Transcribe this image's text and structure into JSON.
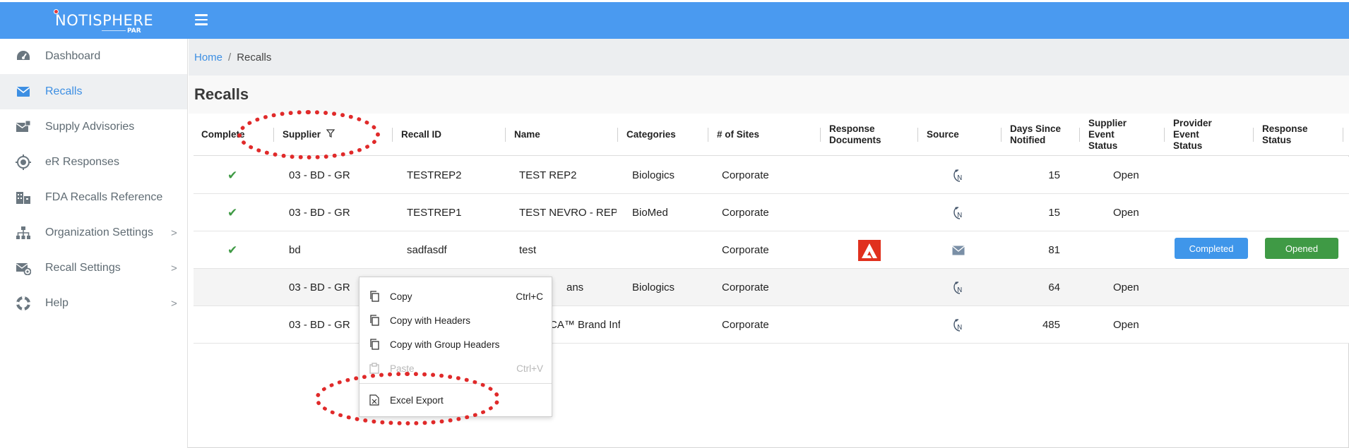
{
  "app": {
    "logo_text": "NOTISPHERE",
    "logo_sub": "PAR"
  },
  "sidebar": {
    "items": [
      {
        "label": "Dashboard",
        "icon": "dashboard-icon"
      },
      {
        "label": "Recalls",
        "icon": "envelope-icon",
        "active": true
      },
      {
        "label": "Supply Advisories",
        "icon": "advisory-icon"
      },
      {
        "label": "eR Responses",
        "icon": "target-icon"
      },
      {
        "label": "FDA Recalls Reference",
        "icon": "building-icon"
      },
      {
        "label": "Organization Settings",
        "icon": "org-chart-icon",
        "chevron": ">"
      },
      {
        "label": "Recall Settings",
        "icon": "mail-settings-icon",
        "chevron": ">"
      },
      {
        "label": "Help",
        "icon": "lifebuoy-icon",
        "chevron": ">"
      }
    ]
  },
  "breadcrumb": {
    "home": "Home",
    "separator": "/",
    "current": "Recalls"
  },
  "page": {
    "title": "Recalls"
  },
  "grid": {
    "columns": [
      "Complete",
      "Supplier",
      "Recall ID",
      "Name",
      "Categories",
      "# of Sites",
      "Response Documents",
      "Source",
      "Days Since Notified",
      "Supplier Event Status",
      "Provider Event Status",
      "Response Status"
    ],
    "rows": [
      {
        "complete": "✔",
        "supplier": "03 - BD - GR",
        "recall_id": "TESTREP2",
        "name": "TEST REP2",
        "categories": "Biologics",
        "sites": "Corporate",
        "doc": "",
        "source": "N",
        "days": "15",
        "supplier_status": "Open",
        "provider_status": "",
        "response_status": ""
      },
      {
        "complete": "✔",
        "supplier": "03 - BD - GR",
        "recall_id": "TESTREP1",
        "name": "TEST NEVRO - REP",
        "categories": "BioMed",
        "sites": "Corporate",
        "doc": "",
        "source": "N",
        "days": "15",
        "supplier_status": "Open",
        "provider_status": "",
        "response_status": ""
      },
      {
        "complete": "✔",
        "supplier": "bd",
        "recall_id": "sadfasdf",
        "name": "test",
        "categories": "",
        "sites": "Corporate",
        "doc": "pdf",
        "source": "mail",
        "days": "81",
        "supplier_status": "",
        "provider_status": "Completed",
        "response_status": "Opened"
      },
      {
        "complete": "",
        "supplier": "03 - BD - GR",
        "recall_id": "",
        "name": "ans",
        "categories": "Biologics",
        "sites": "Corporate",
        "doc": "",
        "source": "N",
        "days": "64",
        "supplier_status": "Open",
        "provider_status": "",
        "response_status": ""
      },
      {
        "complete": "",
        "supplier": "03 - BD - GR",
        "recall_id": "",
        "name": "CA™ Brand Infu",
        "categories": "",
        "sites": "Corporate",
        "doc": "",
        "source": "N",
        "days": "485",
        "supplier_status": "Open",
        "provider_status": "",
        "response_status": ""
      }
    ]
  },
  "context_menu": {
    "items": [
      {
        "label": "Copy",
        "shortcut": "Ctrl+C"
      },
      {
        "label": "Copy with Headers",
        "shortcut": ""
      },
      {
        "label": "Copy with Group Headers",
        "shortcut": ""
      },
      {
        "label": "Paste",
        "shortcut": "Ctrl+V",
        "disabled": true
      },
      {
        "label": "Excel Export",
        "shortcut": ""
      }
    ]
  },
  "colors": {
    "topbar": "#4a9af0",
    "link": "#3d8fe3",
    "check": "#3f9a45",
    "completed_btn": "#3f96ea",
    "opened_btn": "#3f9a45",
    "annotation": "#e02a2a"
  }
}
